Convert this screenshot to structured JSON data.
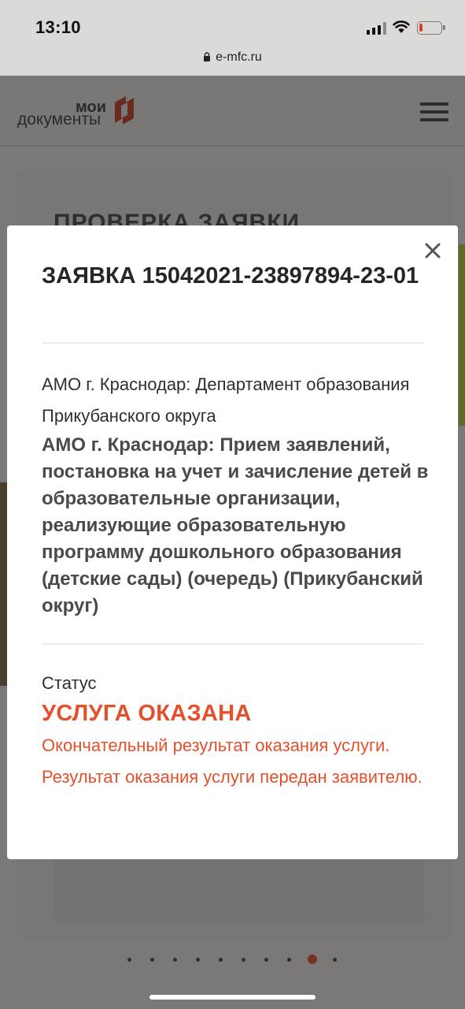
{
  "status_bar": {
    "time": "13:10",
    "signal_icon": "cellular-signal-icon",
    "wifi_icon": "wifi-icon",
    "battery_icon": "battery-low-icon",
    "battery_level": 0.15,
    "battery_color": "#e53a2f"
  },
  "browser": {
    "url": "e-mfc.ru",
    "lock_icon": "lock-icon"
  },
  "site": {
    "logo_top": "мои",
    "logo_bottom": "документы",
    "menu_icon": "hamburger-menu-icon",
    "card_title": "ПРОВЕРКА ЗАЯВКИ",
    "carousel": {
      "count": 10,
      "active_index": 8
    }
  },
  "modal": {
    "close_icon": "close-icon",
    "title": "ЗАЯВКА 15042021-23897894-23-01",
    "department": "АМО г. Краснодар: Департамент образования Прикубанского округа",
    "service": "АМО г. Краснодар: Прием заявлений, постановка на учет и зачисление детей в образовательные организации, реализующие образовательную программу дошкольного образования (детские сады) (очередь) (Прикубанский округ)",
    "status_label": "Статус",
    "status_value": "УСЛУГА ОКАЗАНА",
    "status_description": "Окончательный результат оказания услуги. Результат оказания услуги передан заявителю.",
    "accent_color": "#e4502c"
  }
}
